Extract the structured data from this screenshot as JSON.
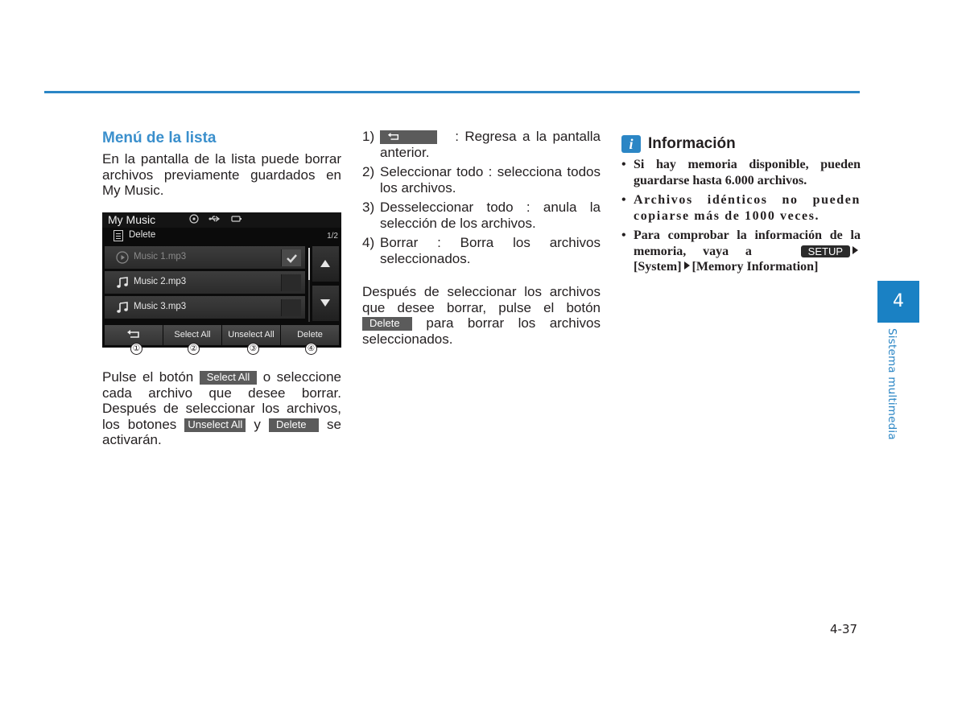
{
  "page": {
    "chapter_number": "4",
    "chapter_title": "Sistema multimedia",
    "page_number": "4-37",
    "accent_color": "#2b86c5"
  },
  "column1": {
    "section_title": "Menú de la lista",
    "intro": "En la pantalla de la lista puede borrar archivos previamente guardados en My Music.",
    "instructions": {
      "part1": "Pulse el botón",
      "select_all_btn": "Select All",
      "part2": "o seleccione cada archivo que desee borrar. Después de seleccionar los archivos, los botones",
      "unselect_all_btn": "Unselect All",
      "part3": "y",
      "delete_btn": "Delete",
      "part4": "se activarán."
    }
  },
  "screen": {
    "title": "My Music",
    "status_icons": [
      "disc-icon",
      "usb-icon",
      "battery-icon"
    ],
    "subheader_label": "Delete",
    "page_indicator": "1/2",
    "rows": [
      {
        "label": "Music 1.mp3",
        "icon": "play-circle-icon",
        "checked": true,
        "dimmed": true
      },
      {
        "label": "Music 2.mp3",
        "icon": "music-note-icon",
        "checked": false,
        "dimmed": false
      },
      {
        "label": "Music 3.mp3",
        "icon": "music-note-icon",
        "checked": false,
        "dimmed": false
      }
    ],
    "bottom_buttons": [
      {
        "label": "",
        "icon": "back-arrow-icon"
      },
      {
        "label": "Select All"
      },
      {
        "label": "Unselect All"
      },
      {
        "label": "Delete"
      }
    ],
    "callouts": [
      "①",
      "②",
      "③",
      "④"
    ]
  },
  "column2": {
    "items": [
      {
        "num": "1)",
        "text": ": Regresa a la pantalla anterior."
      },
      {
        "num": "2)",
        "text": "Seleccionar todo : selecciona todos los archivos."
      },
      {
        "num": "3)",
        "text": "Desseleccionar todo : anula la selección de los archivos."
      },
      {
        "num": "4)",
        "text": "Borrar : Borra los archivos seleccionados."
      }
    ],
    "para": {
      "part1": "Después de seleccionar los archivos que desee borrar, pulse el botón",
      "delete_btn": "Delete",
      "part2": "para borrar los archivos seleccionados."
    }
  },
  "info": {
    "title": "Información",
    "bullets": [
      "Si hay memoria disponible, pueden guardarse hasta 6.000 archivos.",
      "Archivos idénticos no pueden copiarse más de 1000 veces."
    ],
    "last_bullet": {
      "part1": "Para comprobar la información de la memoria, vaya a",
      "setup_btn": "SETUP",
      "part2": "[System]",
      "part3": "[Memory Information]"
    }
  }
}
